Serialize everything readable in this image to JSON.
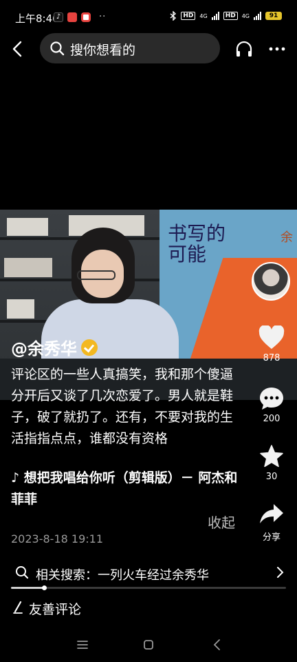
{
  "status": {
    "time": "上午8:46",
    "apps": [
      "tiktok-icon",
      "app-icon-red",
      "app-icon-red-round"
    ],
    "more": "··",
    "network_badges": [
      "HD",
      "4G",
      "HD",
      "4G"
    ],
    "battery": "91",
    "colors": {
      "battery": "#e6c52c"
    }
  },
  "top_bar": {
    "search_placeholder": "搜你想看的"
  },
  "video": {
    "poster_text": "书写的\n可能",
    "poster_text_side": "余"
  },
  "author": {
    "name": "@余秀华",
    "verified": true
  },
  "caption": {
    "text": "评论区的一些人真搞笑，我和那个傻逼分开后又谈了几次恋爱了。男人就是鞋子，破了就扔了。还有，不要对我的生活指指点点，谁都没有资格",
    "music": "♪ 想把我唱给你听（剪辑版）－ 阿杰和菲菲",
    "collapse_label": "收起",
    "timestamp": "2023-8-18 19:11"
  },
  "rail": {
    "like_count": "878",
    "comment_count": "200",
    "favorite_count": "30",
    "share_label": "分享"
  },
  "related_search": {
    "label": "相关搜索：一列火车经过余秀华"
  },
  "playback": {
    "progress_fraction": 0.12
  },
  "comment_entry": {
    "label": "友善评论"
  }
}
